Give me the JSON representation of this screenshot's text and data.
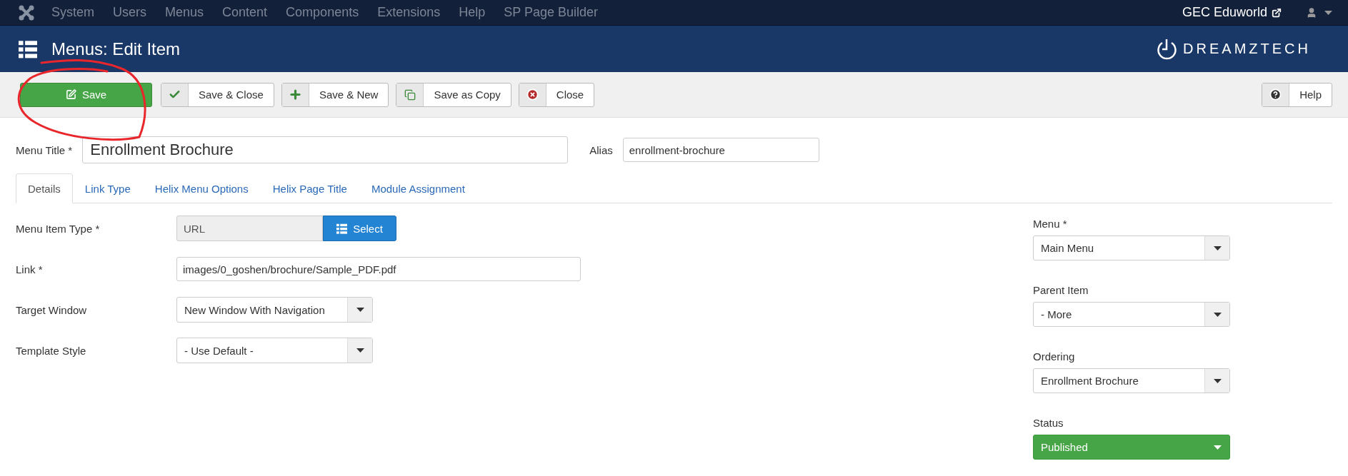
{
  "top_menu": [
    "System",
    "Users",
    "Menus",
    "Content",
    "Components",
    "Extensions",
    "Help",
    "SP Page Builder"
  ],
  "site_link": "GEC Eduworld",
  "page_title": "Menus: Edit Item",
  "logo_text": "DREAMZTECH",
  "toolbar": [
    {
      "label": "Save",
      "kind": "primary"
    },
    {
      "label": "Save & Close",
      "kind": "addon"
    },
    {
      "label": "Save & New",
      "kind": "addon"
    },
    {
      "label": "Save as Copy",
      "kind": "addon"
    },
    {
      "label": "Close",
      "kind": "addon"
    }
  ],
  "help_button": "Help",
  "menu_title": {
    "label": "Menu Title *",
    "value": "Enrollment Brochure"
  },
  "alias": {
    "label": "Alias",
    "value": "enrollment-brochure"
  },
  "tabs": [
    {
      "label": "Details",
      "selected": true
    },
    {
      "label": "Link Type",
      "selected": false
    },
    {
      "label": "Helix Menu Options",
      "selected": false
    },
    {
      "label": "Helix Page Title",
      "selected": false
    },
    {
      "label": "Module Assignment",
      "selected": false
    }
  ],
  "fields": [
    {
      "label": "Menu Item Type *",
      "kind": "type",
      "value": "URL",
      "button": "Select"
    },
    {
      "label": "Link *",
      "kind": "text",
      "value": "images/0_goshen/brochure/Sample_PDF.pdf"
    },
    {
      "label": "Target Window",
      "kind": "select",
      "value": "New Window With Navigation"
    },
    {
      "label": "Template Style",
      "kind": "select",
      "value": "- Use Default -"
    }
  ],
  "side_fields": [
    {
      "label": "Menu *",
      "kind": "select",
      "value": "Main Menu"
    },
    {
      "label": "Parent Item",
      "kind": "select",
      "value": "- More"
    },
    {
      "label": "Ordering",
      "kind": "select",
      "value": "Enrollment Brochure"
    },
    {
      "label": "Status",
      "kind": "status",
      "value": "Published"
    }
  ],
  "annotation": {
    "kind": "circle",
    "color": "#e8262b"
  }
}
